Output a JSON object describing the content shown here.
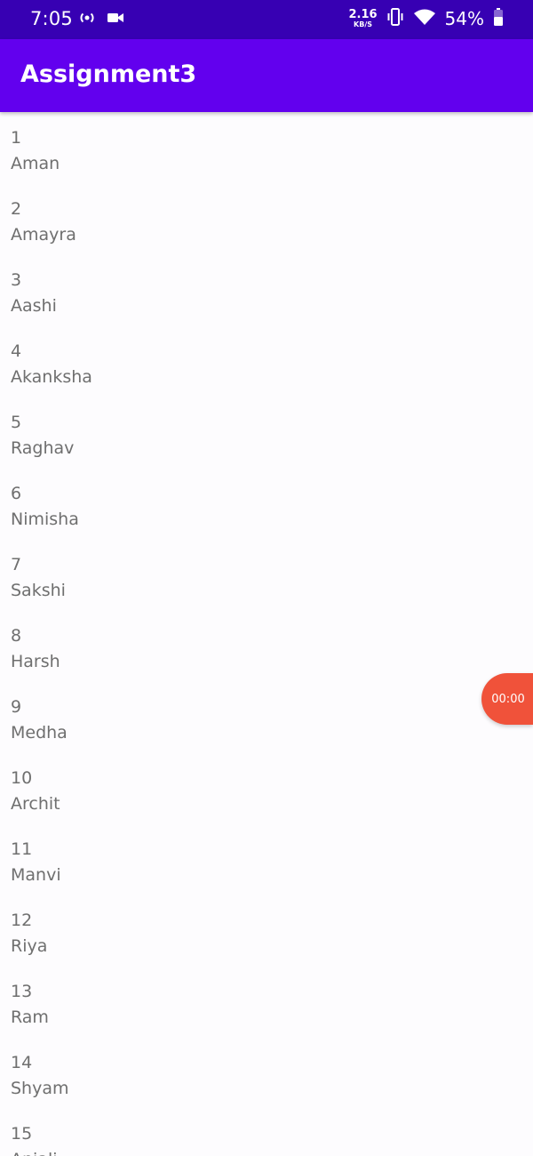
{
  "status_bar": {
    "time": "7:05",
    "net_speed_value": "2.16",
    "net_speed_unit": "KB/S",
    "battery": "54%",
    "icons": [
      "radio-icon",
      "video-camera-icon",
      "vibrate-icon",
      "wifi-icon",
      "battery-icon"
    ]
  },
  "app_bar": {
    "title": "Assignment3",
    "color": "#6200ee",
    "status_color": "#3700b3"
  },
  "list": {
    "items": [
      {
        "id": "1",
        "name": "Aman"
      },
      {
        "id": "2",
        "name": "Amayra"
      },
      {
        "id": "3",
        "name": "Aashi"
      },
      {
        "id": "4",
        "name": "Akanksha"
      },
      {
        "id": "5",
        "name": "Raghav"
      },
      {
        "id": "6",
        "name": "Nimisha"
      },
      {
        "id": "7",
        "name": "Sakshi"
      },
      {
        "id": "8",
        "name": "Harsh"
      },
      {
        "id": "9",
        "name": "Medha"
      },
      {
        "id": "10",
        "name": "Archit"
      },
      {
        "id": "11",
        "name": "Manvi"
      },
      {
        "id": "12",
        "name": "Riya"
      },
      {
        "id": "13",
        "name": "Ram"
      },
      {
        "id": "14",
        "name": "Shyam"
      },
      {
        "id": "15",
        "name": "Anjali"
      }
    ]
  },
  "recorder": {
    "timer": "00:00",
    "color": "#f0523a"
  }
}
